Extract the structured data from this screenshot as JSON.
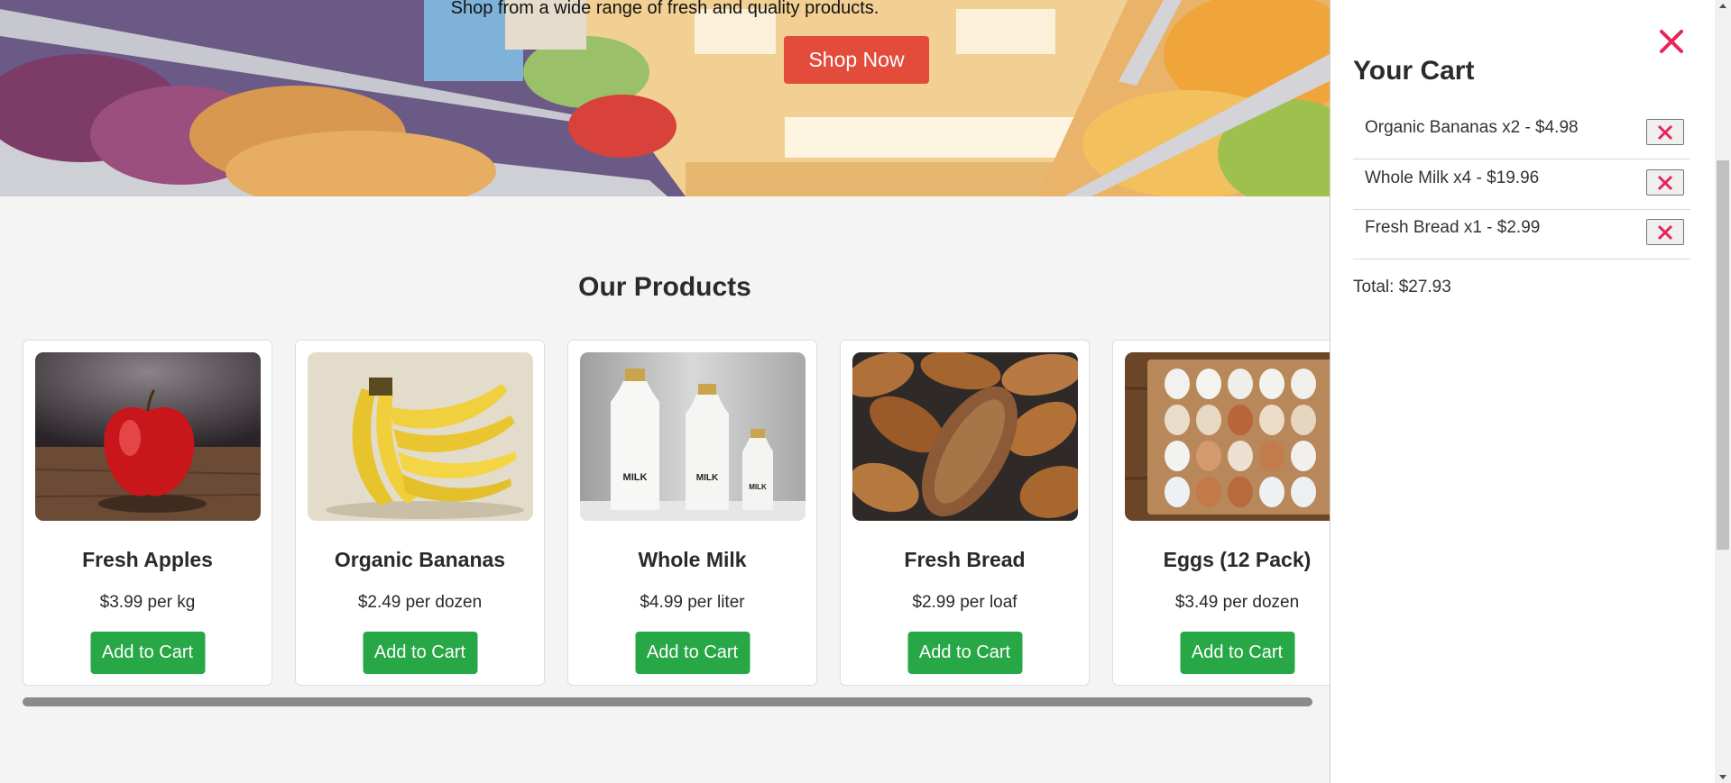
{
  "hero": {
    "subtitle": "Shop from a wide range of fresh and quality products.",
    "shop_button": "Shop Now"
  },
  "products_section": {
    "title": "Our Products",
    "items": [
      {
        "name": "Fresh Apples",
        "price": "$3.99 per kg",
        "button": "Add to Cart",
        "image": "apple-image"
      },
      {
        "name": "Organic Bananas",
        "price": "$2.49 per dozen",
        "button": "Add to Cart",
        "image": "bananas-image"
      },
      {
        "name": "Whole Milk",
        "price": "$4.99 per liter",
        "button": "Add to Cart",
        "image": "milk-image"
      },
      {
        "name": "Fresh Bread",
        "price": "$2.99 per loaf",
        "button": "Add to Cart",
        "image": "bread-image"
      },
      {
        "name": "Eggs (12 Pack)",
        "price": "$3.49 per dozen",
        "button": "Add to Cart",
        "image": "eggs-image"
      }
    ]
  },
  "cart": {
    "title": "Your Cart",
    "items": [
      {
        "label": "Organic Bananas x2 - $4.98"
      },
      {
        "label": "Whole Milk x4 - $19.96"
      },
      {
        "label": "Fresh Bread x1 - $2.99"
      }
    ],
    "total": "Total: $27.93"
  },
  "colors": {
    "accent_red": "#e34b3b",
    "add_button_green": "#27a745",
    "close_pink": "#e8245b"
  },
  "icons": {
    "close": "close-icon",
    "remove": "remove-icon"
  }
}
